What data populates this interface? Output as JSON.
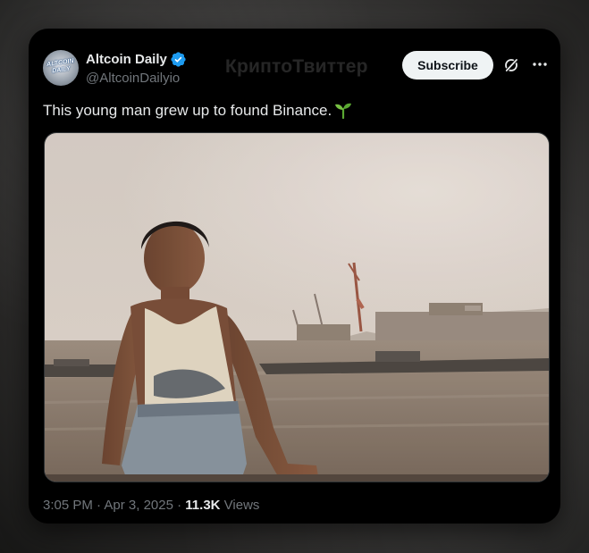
{
  "author": {
    "display_name": "Altcoin Daily",
    "handle": "@AltcoinDailyio",
    "avatar_text_line1": "ALTCOIN",
    "avatar_text_line2": "DAILY",
    "verified_icon": "verified-badge-icon",
    "verified_color": "#1d9bf0"
  },
  "watermark": "КриптоТвиттер",
  "actions": {
    "subscribe_label": "Subscribe",
    "grok_icon": "grok-icon",
    "more_icon": "more-dots-icon"
  },
  "tweet": {
    "text": "This young man grew up to found Binance.",
    "emoji_icon": "seedling-icon"
  },
  "media": {
    "type": "photo",
    "subject": "boy-sitting-by-river-photo"
  },
  "meta": {
    "time": "3:05 PM",
    "separator": "·",
    "date": "Apr 3, 2025",
    "views_count": "11.3K",
    "views_label": "Views"
  },
  "colors": {
    "card_bg": "#000000",
    "text_primary": "#e7e9ea",
    "text_secondary": "#71767b",
    "button_bg": "#eff3f4"
  }
}
